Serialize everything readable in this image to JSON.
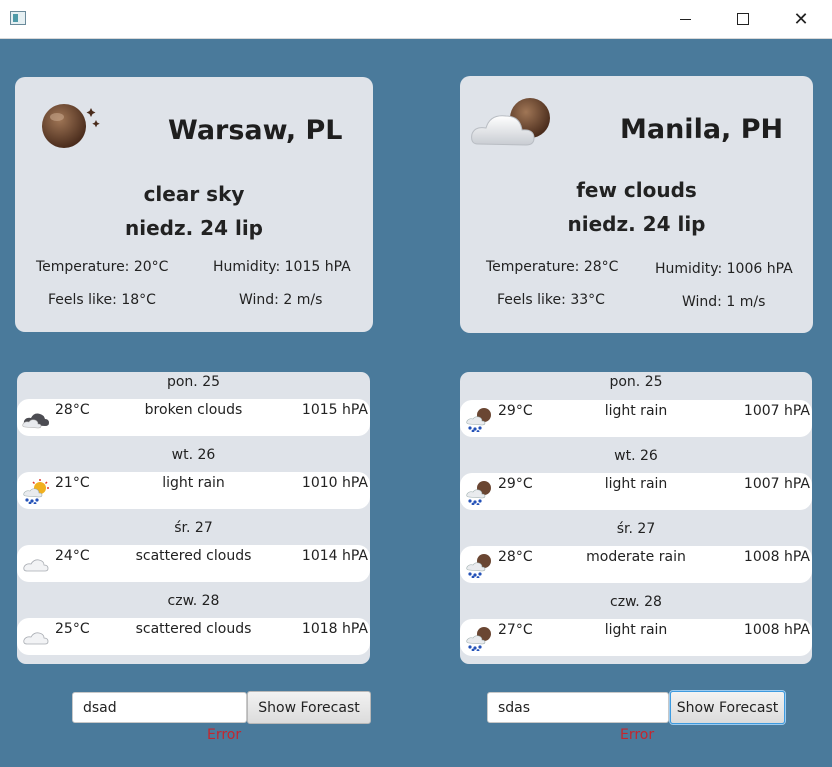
{
  "window": {
    "minimize": "",
    "maximize": "",
    "close": "✕"
  },
  "colors": {
    "background": "#4a7a9b",
    "card": "#dfe3e9",
    "error": "#c4262e"
  },
  "left": {
    "city": "Warsaw, PL",
    "description": "clear sky",
    "date": "niedz. 24 lip",
    "temperature": "Temperature: 20°C",
    "humidity": "Humidity: 1015 hPA",
    "feels_like": "Feels like: 18°C",
    "wind": "Wind: 2 m/s",
    "icon": "moon-clear-night-icon",
    "forecast": [
      {
        "day": "pon. 25",
        "icon": "cloudy-night-icon",
        "temp": "28°C",
        "desc": "broken clouds",
        "pressure": "1015 hPA"
      },
      {
        "day": "wt. 26",
        "icon": "sun-rain-icon",
        "temp": "21°C",
        "desc": "light rain",
        "pressure": "1010 hPA"
      },
      {
        "day": "śr. 27",
        "icon": "cloud-icon",
        "temp": "24°C",
        "desc": "scattered clouds",
        "pressure": "1014 hPA"
      },
      {
        "day": "czw. 28",
        "icon": "cloud-icon",
        "temp": "25°C",
        "desc": "scattered clouds",
        "pressure": "1018 hPA"
      }
    ],
    "search_value": "dsad",
    "button": "Show Forecast",
    "error": "Error"
  },
  "right": {
    "city": "Manila, PH",
    "description": "few clouds",
    "date": "niedz. 24 lip",
    "temperature": "Temperature: 28°C",
    "humidity": "Humidity: 1006 hPA",
    "feels_like": "Feels like: 33°C",
    "wind": "Wind: 1 m/s",
    "icon": "cloud-moon-icon",
    "forecast": [
      {
        "day": "pon. 25",
        "icon": "moon-rain-icon",
        "temp": "29°C",
        "desc": "light rain",
        "pressure": "1007 hPA"
      },
      {
        "day": "wt. 26",
        "icon": "moon-rain-icon",
        "temp": "29°C",
        "desc": "light rain",
        "pressure": "1007 hPA"
      },
      {
        "day": "śr. 27",
        "icon": "moon-rain-icon",
        "temp": "28°C",
        "desc": "moderate rain",
        "pressure": "1008 hPA"
      },
      {
        "day": "czw. 28",
        "icon": "moon-rain-icon",
        "temp": "27°C",
        "desc": "light rain",
        "pressure": "1008 hPA"
      }
    ],
    "search_value": "sdas",
    "button": "Show Forecast",
    "error": "Error"
  }
}
